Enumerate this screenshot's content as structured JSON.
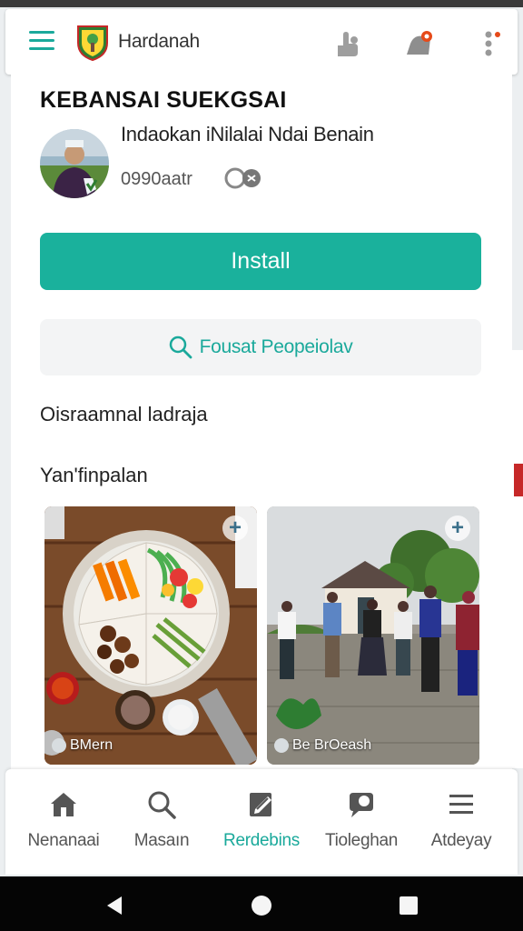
{
  "app": {
    "title": "Hardanah"
  },
  "header": {
    "icons": [
      "menu-icon",
      "app-logo",
      "share-icon",
      "notification-icon",
      "more-vert-icon"
    ],
    "accent": "#1aa99b",
    "badge_color": "#e64a19"
  },
  "listing": {
    "title": "KEBANSAI SUEKGSAI",
    "developer": "Indaokan iNilalai Ndai Benain",
    "rating": "0990aatr",
    "install_label": "Install",
    "install_color": "#1ab19c",
    "search_label": "Fousat Peopeiolav"
  },
  "sections": {
    "first": "Oisraamnal ladraja",
    "second": "Yan'finpalan"
  },
  "cards": [
    {
      "caption": "BMern",
      "icon": "plus-icon"
    },
    {
      "caption": "Be BrOeash",
      "icon": "plus-icon"
    }
  ],
  "nav": {
    "items": [
      {
        "label": "Nenanaai",
        "icon": "home-icon",
        "active": false
      },
      {
        "label": "Masaın",
        "icon": "search-icon",
        "active": false
      },
      {
        "label": "Rerdebins",
        "icon": "edit-icon",
        "active": true
      },
      {
        "label": "Tioleghan",
        "icon": "chat-icon",
        "active": false
      },
      {
        "label": "Atdeyay",
        "icon": "list-icon",
        "active": false
      }
    ]
  },
  "system": {
    "icons": [
      "back-icon",
      "home-circle-icon",
      "recents-icon"
    ]
  }
}
